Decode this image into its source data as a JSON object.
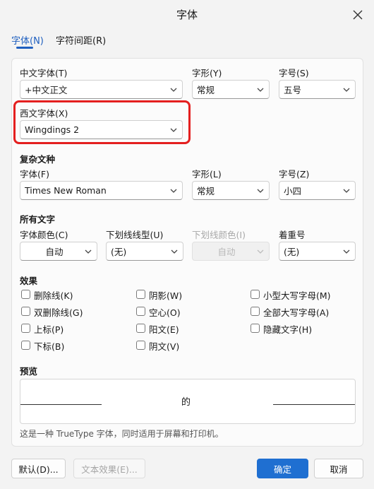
{
  "dialog": {
    "title": "字体"
  },
  "tabs": [
    {
      "label": "字体(N)"
    },
    {
      "label": "字符间距(R)"
    }
  ],
  "chinese_font": {
    "label": "中文字体(T)",
    "value": "+中文正文"
  },
  "style1": {
    "label": "字形(Y)",
    "value": "常规"
  },
  "size1": {
    "label": "字号(S)",
    "value": "五号"
  },
  "western_font": {
    "label": "西文字体(X)",
    "value": "Wingdings 2"
  },
  "complex": {
    "heading": "复杂文种",
    "font_label": "字体(F)",
    "font_value": "Times New Roman",
    "style_label": "字形(L)",
    "style_value": "常规",
    "size_label": "字号(Z)",
    "size_value": "小四"
  },
  "all_text": {
    "heading": "所有文字",
    "color_label": "字体颜色(C)",
    "color_value": "自动",
    "underline_label": "下划线线型(U)",
    "underline_value": "(无)",
    "underline_color_label": "下划线颜色(I)",
    "underline_color_value": "自动",
    "emphasis_label": "着重号",
    "emphasis_value": "(无)"
  },
  "effects": {
    "heading": "效果",
    "items": [
      {
        "label": "删除线(K)",
        "checked": false
      },
      {
        "label": "双删除线(G)",
        "checked": false
      },
      {
        "label": "上标(P)",
        "checked": false
      },
      {
        "label": "下标(B)",
        "checked": false
      },
      {
        "label": "阴影(W)",
        "checked": false
      },
      {
        "label": "空心(O)",
        "checked": false
      },
      {
        "label": "阳文(E)",
        "checked": false
      },
      {
        "label": "阴文(V)",
        "checked": false
      },
      {
        "label": "小型大写字母(M)",
        "checked": false
      },
      {
        "label": "全部大写字母(A)",
        "checked": false
      },
      {
        "label": "隐藏文字(H)",
        "checked": false
      }
    ]
  },
  "preview": {
    "heading": "预览",
    "sample": "的"
  },
  "note": "这是一种 TrueType 字体，同时适用于屏幕和打印机。",
  "buttons": {
    "default": "默认(D)...",
    "text_effects": "文本效果(E)...",
    "ok": "确定",
    "cancel": "取消"
  },
  "colors": {
    "accent": "#1f6fd1",
    "highlight": "#e41f1f"
  },
  "icons": {
    "close": "close-icon",
    "dropdown": "chevron-down-icon"
  }
}
